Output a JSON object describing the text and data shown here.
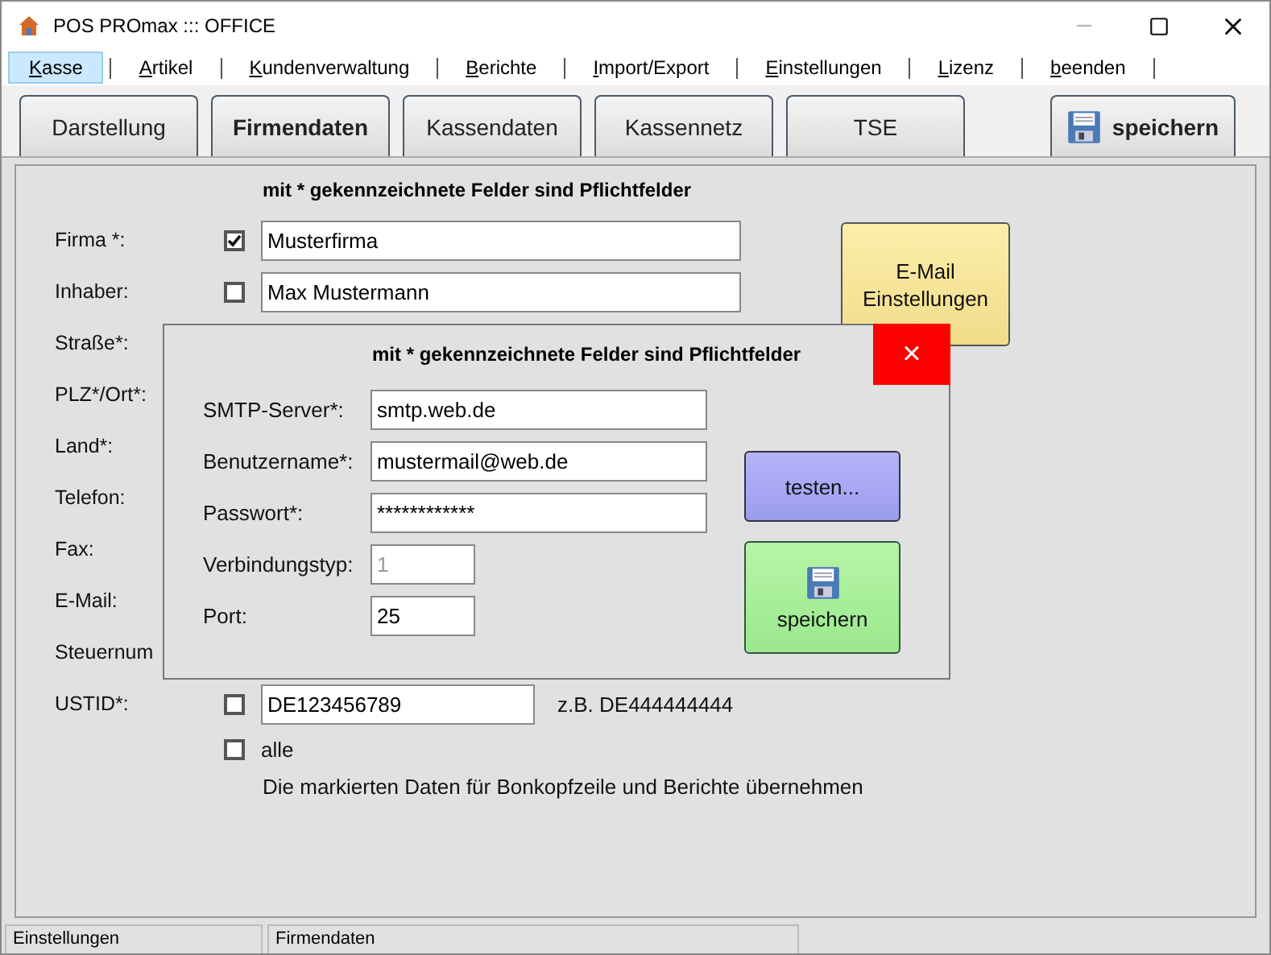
{
  "window": {
    "title": "POS PROmax ::: OFFICE"
  },
  "menu": [
    {
      "label": "Kasse",
      "selected": true
    },
    {
      "label": "Artikel",
      "selected": false
    },
    {
      "label": "Kundenverwaltung",
      "selected": false
    },
    {
      "label": "Berichte",
      "selected": false
    },
    {
      "label": "Import/Export",
      "selected": false
    },
    {
      "label": "Einstellungen",
      "selected": false
    },
    {
      "label": "Lizenz",
      "selected": false
    },
    {
      "label": "beenden",
      "selected": false
    }
  ],
  "tabs": [
    {
      "label": "Darstellung",
      "selected": false
    },
    {
      "label": "Firmendaten",
      "selected": true
    },
    {
      "label": "Kassendaten",
      "selected": false
    },
    {
      "label": "Kassennetz",
      "selected": false
    },
    {
      "label": "TSE",
      "selected": false
    }
  ],
  "save_button": {
    "label": "speichern"
  },
  "form": {
    "header": "mit * gekennzeichnete Felder sind Pflichtfelder",
    "rows": [
      {
        "label": "Firma *:",
        "checked": true,
        "value": "Musterfirma"
      },
      {
        "label": "Inhaber:",
        "checked": false,
        "value": "Max Mustermann"
      },
      {
        "label": "Straße*:"
      },
      {
        "label": "PLZ*/Ort*:"
      },
      {
        "label": "Land*:"
      },
      {
        "label": "Telefon:"
      },
      {
        "label": "Fax:"
      },
      {
        "label": "E-Mail:"
      },
      {
        "label": "Steuernum"
      },
      {
        "label": "USTID*:",
        "checked": false,
        "value": "DE123456789",
        "hint": "z.B. DE444444444"
      }
    ],
    "all": {
      "label": "alle",
      "checked": false
    },
    "note": "Die markierten Daten für Bonkopfzeile und Berichte übernehmen"
  },
  "email_button": {
    "label": "E-Mail Einstellungen"
  },
  "dialog": {
    "title": "mit * gekennzeichnete Felder sind Pflichtfelder",
    "close": "×",
    "fields": [
      {
        "label": "SMTP-Server*:",
        "value": "smtp.web.de",
        "kind": "wide",
        "disabled": false
      },
      {
        "label": "Benutzername*:",
        "value": "mustermail@web.de",
        "kind": "wide",
        "disabled": false
      },
      {
        "label": "Passwort*:",
        "value": "************",
        "kind": "wide",
        "disabled": false
      },
      {
        "label": "Verbindungstyp:",
        "value": "1",
        "kind": "short",
        "disabled": true
      },
      {
        "label": "Port:",
        "value": "25",
        "kind": "short",
        "disabled": false
      }
    ],
    "test_button": {
      "label": "testen..."
    },
    "save_button": {
      "label": "speichern"
    }
  },
  "status_bar": [
    "Einstellungen",
    "Firmendaten"
  ]
}
